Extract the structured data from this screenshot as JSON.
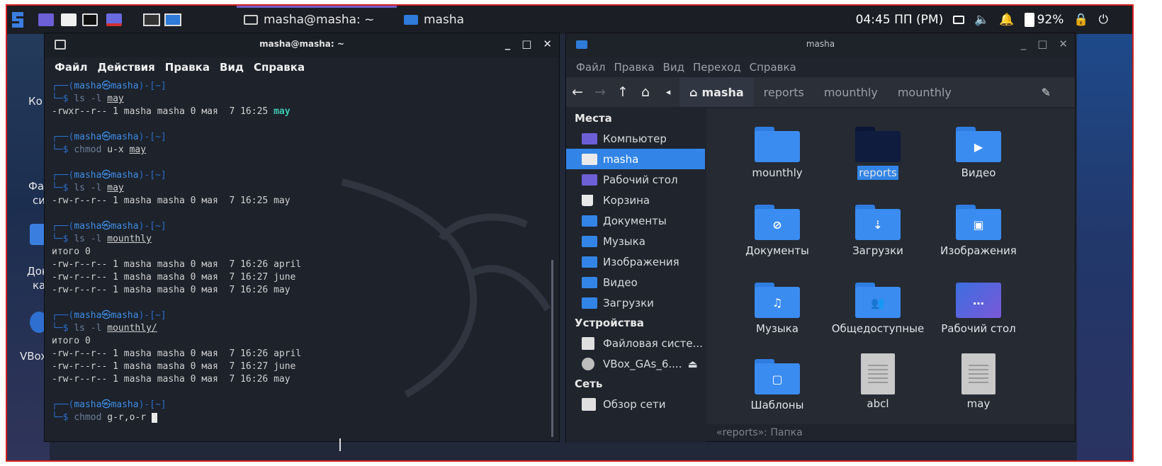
{
  "panel": {
    "terminal_task": "masha@masha: ~",
    "files_task": "masha",
    "clock": "04:45 ПП (PM)",
    "battery": "92%"
  },
  "desktop": {
    "labels": [
      "Ко",
      "Фа",
      "си",
      "Док",
      "ка",
      "VBox"
    ]
  },
  "terminal": {
    "title": "masha@masha: ~",
    "controls": [
      "_",
      "□",
      "✕"
    ],
    "menu": [
      "Файл",
      "Действия",
      "Правка",
      "Вид",
      "Справка"
    ],
    "blocks": [
      {
        "cmd": "ls",
        "args": " -l ",
        "arg_u": "may",
        "out": [
          "-rwxr--r-- 1 masha masha 0 мая  7 16:25 "
        ],
        "out_hl": "may"
      },
      {
        "cmd": "chmod",
        "args": " u-x ",
        "arg_u": "may",
        "out": []
      },
      {
        "cmd": "ls",
        "args": " -l ",
        "arg_u": "may",
        "out": [
          "-rw-r--r-- 1 masha masha 0 мая  7 16:25 may"
        ]
      },
      {
        "cmd": "ls",
        "args": " -l ",
        "arg_u": "mounthly",
        "out": [
          "итого 0",
          "-rw-r--r-- 1 masha masha 0 мая  7 16:26 april",
          "-rw-r--r-- 1 masha masha 0 мая  7 16:27 june",
          "-rw-r--r-- 1 masha masha 0 мая  7 16:26 may"
        ]
      },
      {
        "cmd": "ls",
        "args": " -l ",
        "arg_u": "mounthly/",
        "out": [
          "итого 0",
          "-rw-r--r-- 1 masha masha 0 мая  7 16:26 april",
          "-rw-r--r-- 1 masha masha 0 мая  7 16:27 june",
          "-rw-r--r-- 1 masha masha 0 мая  7 16:26 may"
        ]
      }
    ],
    "prompt_open": "┌──(",
    "prompt_user": "masha㉿masha",
    "prompt_dir": ")-[~]",
    "prompt_mark": "└─$ ",
    "current_cmd": "chmod",
    "current_args": " g-r,o-r "
  },
  "files": {
    "title": "masha",
    "controls": [
      "_",
      "□",
      "✕"
    ],
    "menu": [
      "Файл",
      "Правка",
      "Вид",
      "Переход",
      "Справка"
    ],
    "nav_buttons": [
      "←",
      "→",
      "↑",
      "⌂",
      "◂"
    ],
    "breadcrumbs": [
      "masha",
      "reports",
      "mounthly",
      "mounthly"
    ],
    "sidebar": {
      "places_title": "Места",
      "places": [
        "Компьютер",
        "masha",
        "Рабочий стол",
        "Корзина",
        "Документы",
        "Музыка",
        "Изображения",
        "Видео",
        "Загрузки"
      ],
      "devices_title": "Устройства",
      "devices": [
        "Файловая систе...",
        "VBox_GAs_6...."
      ],
      "network_title": "Сеть",
      "network": [
        "Обзор сети"
      ]
    },
    "items": [
      "mounthly",
      "reports",
      "Видео",
      "Документы",
      "Загрузки",
      "Изображения",
      "Музыка",
      "Общедоступные",
      "Рабочий стол",
      "Шаблоны",
      "abcl",
      "may"
    ],
    "status": "«reports»: Папка"
  }
}
